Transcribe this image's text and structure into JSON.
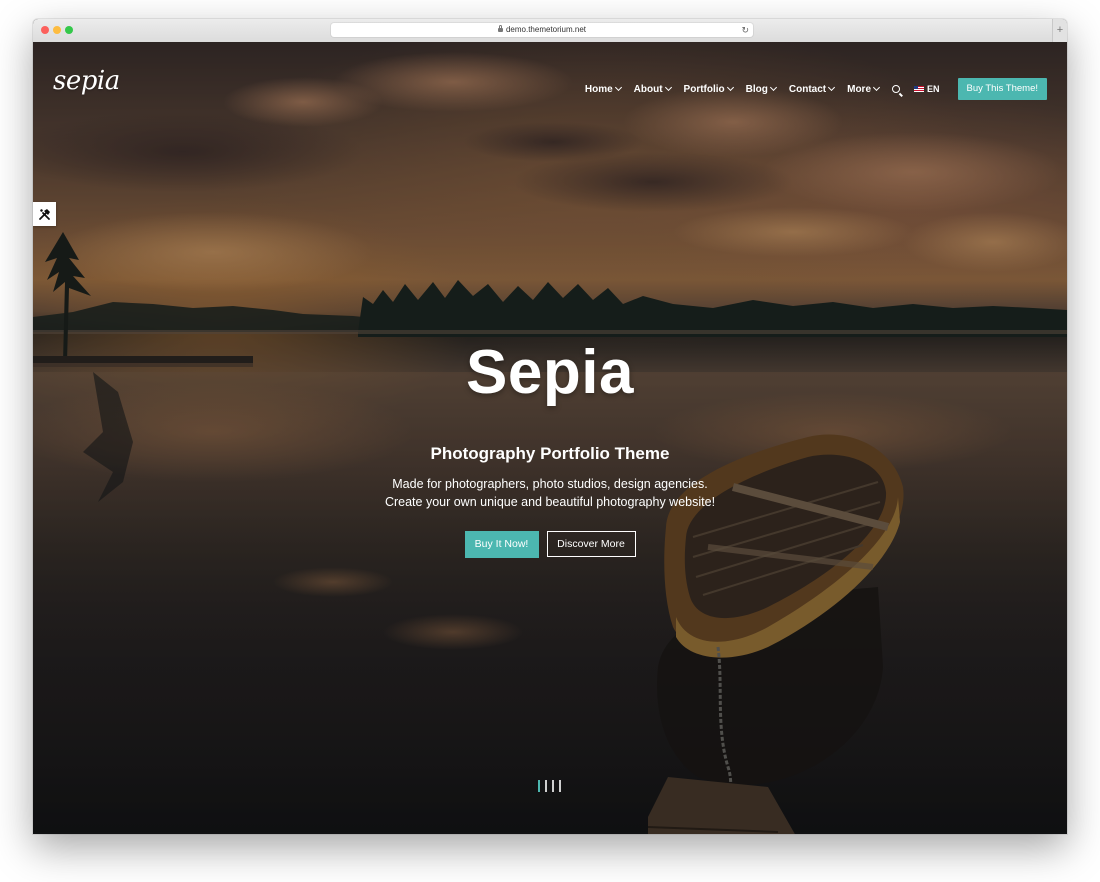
{
  "browser": {
    "url": "demo.themetorium.net"
  },
  "site": {
    "logo_text": "sepia"
  },
  "nav": {
    "items": [
      {
        "label": "Home"
      },
      {
        "label": "About"
      },
      {
        "label": "Portfolio"
      },
      {
        "label": "Blog"
      },
      {
        "label": "Contact"
      },
      {
        "label": "More"
      }
    ],
    "language": "EN",
    "cta_label": "Buy This Theme!"
  },
  "hero": {
    "title": "Sepia",
    "subtitle": "Photography Portfolio Theme",
    "description_line1": "Made for photographers, photo studios, design agencies.",
    "description_line2": "Create your own unique and beautiful photography website!",
    "primary_button": "Buy It Now!",
    "secondary_button": "Discover More",
    "slides_total": 4,
    "slide_active": 1
  },
  "colors": {
    "accent": "#4cb7b0",
    "text": "#ffffff"
  },
  "icons": {
    "search": "search-icon",
    "flag": "us-flag-icon",
    "tools": "hammer-wrench-icon",
    "lock": "lock-icon",
    "reload": "reload-icon"
  }
}
